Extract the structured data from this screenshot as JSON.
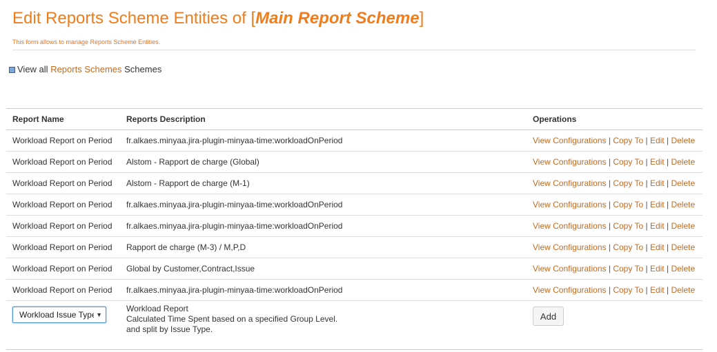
{
  "header": {
    "title_prefix": "Edit Reports Scheme Entities of [",
    "scheme_name": "Main Report Scheme",
    "title_suffix": "]",
    "subtitle": "This form allows to manage Reports Scheme Entities."
  },
  "nav": {
    "view_all_prefix": "View all",
    "view_all_link": "Reports Schemes",
    "view_all_suffix": "Schemes"
  },
  "table": {
    "columns": [
      "Report Name",
      "Reports Description",
      "Operations"
    ],
    "operations": [
      "View Configurations",
      "Copy To",
      "Edit",
      "Delete"
    ],
    "separator": "|",
    "rows": [
      {
        "name": "Workload Report on Period",
        "description": "fr.alkaes.minyaa.jira-plugin-minyaa-time:workloadOnPeriod"
      },
      {
        "name": "Workload Report on Period",
        "description": "Alstom - Rapport de charge (Global)"
      },
      {
        "name": "Workload Report on Period",
        "description": "Alstom - Rapport de charge (M-1)"
      },
      {
        "name": "Workload Report on Period",
        "description": "fr.alkaes.minyaa.jira-plugin-minyaa-time:workloadOnPeriod"
      },
      {
        "name": "Workload Report on Period",
        "description": "fr.alkaes.minyaa.jira-plugin-minyaa-time:workloadOnPeriod"
      },
      {
        "name": "Workload Report on Period",
        "description": "Rapport de charge (M-3) / M,P,D"
      },
      {
        "name": "Workload Report on Period",
        "description": "Global by Customer,Contract,Issue"
      },
      {
        "name": "Workload Report on Period",
        "description": "fr.alkaes.minyaa.jira-plugin-minyaa-time:workloadOnPeriod"
      }
    ]
  },
  "add_row": {
    "select_value": "Workload Issue Type",
    "description_lines": [
      "Workload Report",
      "Calculated Time Spent based on a specified Group Level.",
      "and split by Issue Type."
    ],
    "add_label": "Add"
  },
  "colors": {
    "accent": "#f07d1c",
    "link": "#c36a1f"
  }
}
